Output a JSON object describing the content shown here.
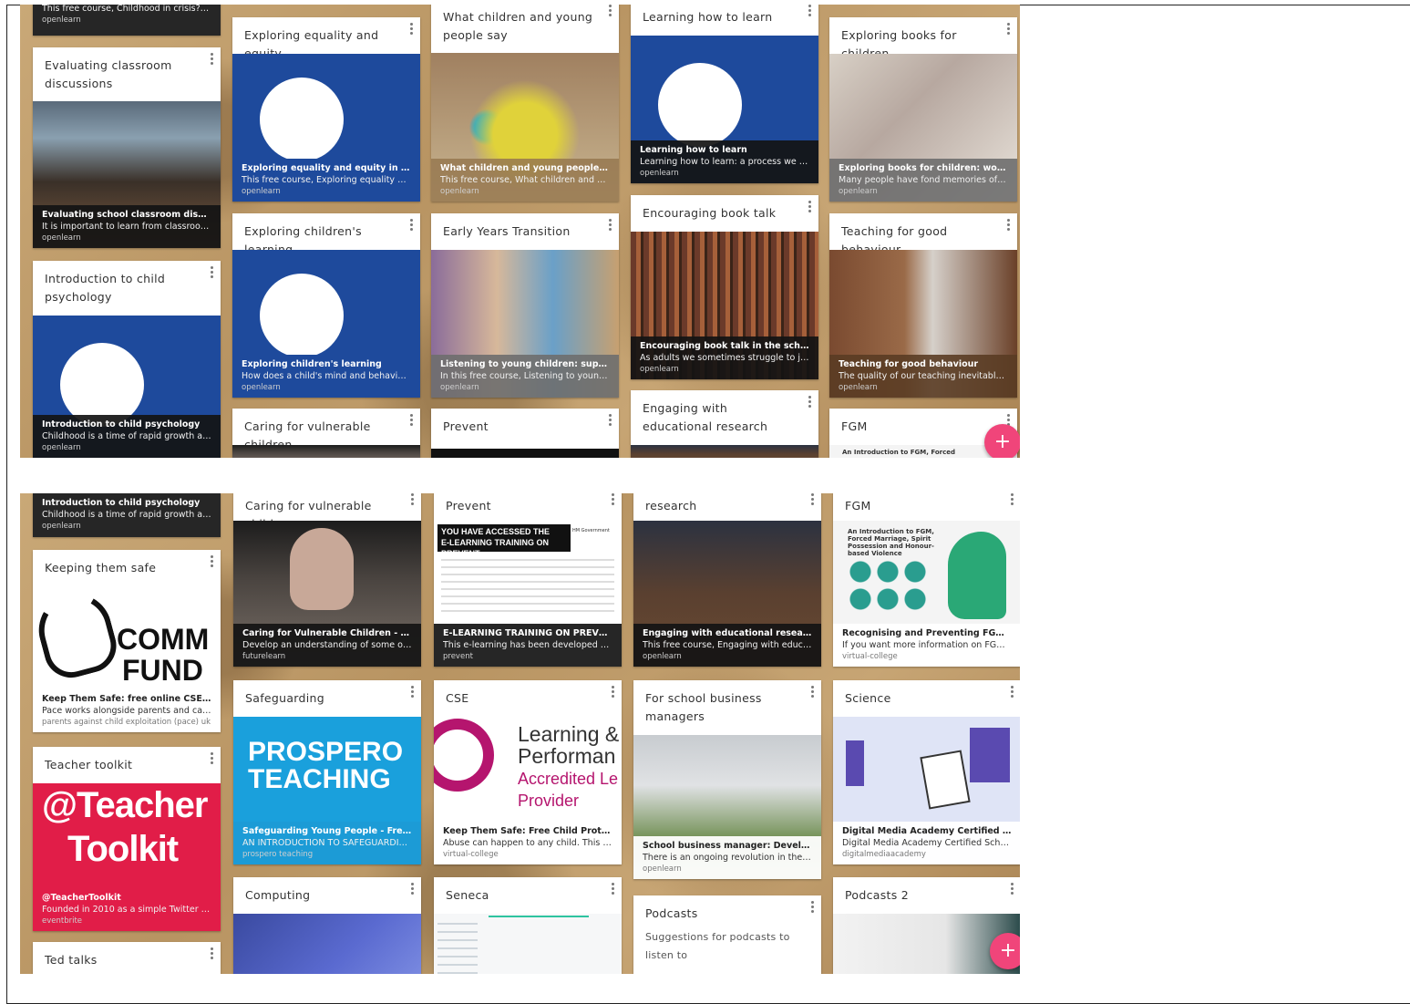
{
  "top": {
    "col1": {
      "partial_caption": "This free course, Childhood in crisis?, ex...",
      "partial_src": "openlearn",
      "card_a": {
        "title": "Evaluating classroom discussions",
        "cap_title": "Evaluating school classroom discussion",
        "cap_desc": "It is important to learn from classroom ...",
        "src": "openlearn"
      },
      "card_b": {
        "title": "Introduction to child psychology",
        "cap_title": "Introduction to child psychology",
        "cap_desc": "Childhood is a time of rapid growth and ...",
        "src": "openlearn"
      }
    },
    "col2": {
      "card_a": {
        "title": "Exploring equality and equity",
        "cap_title": "Exploring equality and equity in educati...",
        "cap_desc": "This free course, Exploring equality and ...",
        "src": "openlearn"
      },
      "card_b": {
        "title": "Exploring children's learning",
        "cap_title": "Exploring children's learning",
        "cap_desc": "How does a child's mind and behaviour ...",
        "src": "openlearn"
      },
      "card_c": {
        "title": "Caring for vulnerable children"
      }
    },
    "col3": {
      "card_a": {
        "title": "What children and young people say",
        "cap_title": "What children and young people say",
        "cap_desc": "This free course, What children and you...",
        "src": "openlearn"
      },
      "card_b": {
        "title": "Early Years Transition",
        "cap_title": "Listening to young children: supporting ...",
        "cap_desc": "In this free course, Listening to young c...",
        "src": "openlearn"
      },
      "card_c": {
        "title": "Prevent"
      }
    },
    "col4": {
      "card_a": {
        "title": "Learning how to learn",
        "cap_title": "Learning how to learn",
        "cap_desc": "Learning how to learn: a process we all ...",
        "src": "openlearn"
      },
      "card_b": {
        "title": "Encouraging book talk",
        "cap_title": "Encouraging book talk in the school libr...",
        "cap_desc": "As adults we sometimes struggle to just...",
        "src": "openlearn"
      },
      "card_c": {
        "title": "Engaging with educational research"
      }
    },
    "col5": {
      "card_a": {
        "title": "Exploring books for children",
        "cap_title": "Exploring books for children: words and...",
        "cap_desc": "Many people have fond memories of the...",
        "src": "openlearn"
      },
      "card_b": {
        "title": "Teaching for good behaviour",
        "cap_title": "Teaching for good behaviour",
        "cap_desc": "The quality of our teaching inevitably ha...",
        "src": "openlearn"
      },
      "card_c": {
        "title": "FGM",
        "thumb_text": "An Introduction to FGM, Forced"
      }
    }
  },
  "bottom": {
    "col1": {
      "partial": {
        "cap_title": "Introduction to child psychology",
        "cap_desc": "Childhood is a time of rapid growth and ...",
        "src": "openlearn"
      },
      "card_a": {
        "title": "Keeping them safe",
        "logo_top": "COMM",
        "logo_bottom": "FUND",
        "cap_title": "Keep Them Safe: free online CSE training",
        "cap_desc": "Pace works alongside parents and carer...",
        "src": "parents against child exploitation (pace) uk"
      },
      "card_b": {
        "title": "Teacher toolkit",
        "logo_1": "@Teacher",
        "logo_2": "Toolkit",
        "cap_title": "@TeacherToolkit",
        "cap_desc": "Founded in 2010 as a simple Twitter ac...",
        "src": "eventbrite"
      },
      "card_c": {
        "title": "Ted talks"
      }
    },
    "col2": {
      "card_a": {
        "title": "Caring for vulnerable children",
        "cap_title": "Caring for Vulnerable Children - Online ...",
        "cap_desc": "Develop an understanding of some of th...",
        "src": "futurelearn"
      },
      "card_b": {
        "title": "Safeguarding",
        "logo_1": "PROSPERO",
        "logo_2": "TEACHING",
        "cap_title": "Safeguarding Young People - Free Accr...",
        "cap_desc": "AN INTRODUCTION TO SAFEGUARDING...",
        "src": "prospero teaching"
      },
      "card_c": {
        "title": "Computing"
      }
    },
    "col3": {
      "card_a": {
        "title": "Prevent",
        "banner_1": "YOU HAVE ACCESSED THE",
        "banner_2": "E-LEARNING TRAINING ON PREVENT",
        "gov": "HM Government",
        "cap_title": "E-LEARNING TRAINING ON PREVENT",
        "cap_desc": "This e-learning has been developed by H...",
        "src": "prevent"
      },
      "card_b": {
        "title": "CSE",
        "logo_1": "Learning &",
        "logo_2": "Performan",
        "logo_3": "Accredited Le",
        "logo_4": "Provider",
        "cap_title": "Keep Them Safe: Free Child Protection ...",
        "cap_desc": "Abuse can happen to any child. This Chi...",
        "src": "virtual-college"
      },
      "card_c": {
        "title": "Seneca"
      }
    },
    "col4": {
      "card_a": {
        "title": "research",
        "cap_title": "Engaging with educational research",
        "cap_desc": "This free course, Engaging with educati...",
        "src": "openlearn"
      },
      "card_b": {
        "title": "For school business managers",
        "cap_title": "School business manager: Developing t...",
        "cap_desc": "There is an ongoing revolution in the run...",
        "src": "openlearn"
      },
      "card_c": {
        "title": "Podcasts",
        "body": "Suggestions for podcasts to listen to"
      }
    },
    "col5": {
      "card_a": {
        "title": "FGM",
        "thumb_text": "An Introduction to FGM, Forced Marriage, Spirit Possession and Honour-based Violence",
        "cap_title": "Recognising and Preventing FGM Free ...",
        "cap_desc": "If you want more information on FGM or...",
        "src": "virtual-college"
      },
      "card_b": {
        "title": "Science",
        "cap_title": "Digital Media Academy Certified School...",
        "cap_desc": "Digital Media Academy Certified School...",
        "src": "digitalmediaacademy"
      },
      "card_c": {
        "title": "Podcasts 2"
      }
    }
  },
  "fab_label": "+",
  "colors": {
    "accent_fab": "#f0457a",
    "blue_card": "#1e4a9c",
    "teacher_red": "#e11d48",
    "prospero_blue": "#1aa0dc"
  }
}
